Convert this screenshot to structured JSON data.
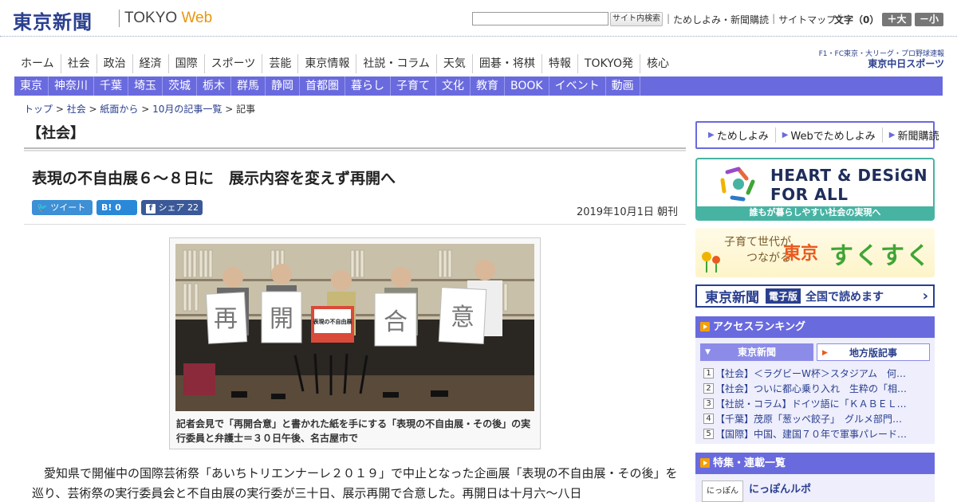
{
  "header": {
    "logo": "東京新聞",
    "logo_tokyo": "TOKYO ",
    "logo_web": "Web",
    "search_placeholder": "",
    "search_button": "サイト内検索",
    "links": [
      "ためしよみ・新聞購読",
      "サイトマップ"
    ],
    "fontsize_label": "文字（0）",
    "font_plus": "＋大",
    "font_minus": "－小"
  },
  "nav_main": [
    "ホーム",
    "社会",
    "政治",
    "経済",
    "国際",
    "スポーツ",
    "芸能",
    "東京情報",
    "社説・コラム",
    "天気",
    "囲碁・将棋",
    "特報",
    "TOKYO発",
    "核心"
  ],
  "chunichi": {
    "line1": "F1・FC東京・大リーグ・プロ野球速報",
    "line2": "東京中日スポーツ"
  },
  "nav_local": [
    "東京",
    "神奈川",
    "千葉",
    "埼玉",
    "茨城",
    "栃木",
    "群馬",
    "静岡",
    "首都圏",
    "暮らし",
    "子育て",
    "文化",
    "教育",
    "BOOK",
    "イベント",
    "動画"
  ],
  "breadcrumb": [
    "トップ",
    "社会",
    "紙面から",
    "10月の記事一覧",
    "記事"
  ],
  "article": {
    "section": "【社会】",
    "headline": "表現の不自由展６～８日に　展示内容を変えず再開へ",
    "share_tweet": "ツイート",
    "share_hatena": "B! 0",
    "share_fb": "シェア 22",
    "date": "2019年10月1日 朝刊",
    "photo_signs": [
      "再",
      "開",
      "合",
      "意"
    ],
    "photo_sign_center": "表現の不自由展",
    "caption": "記者会見で「再開合意」と書かれた紙を手にする「表現の不自由展・その後」の実行委員と弁護士＝３０日午後、名古屋市で",
    "body": "愛知県で開催中の国際芸術祭「あいちトリエンナーレ２０１９」で中止となった企画展「表現の不自由展・その後」を巡り、芸術祭の実行委員会と不自由展の実行委が三十日、展示再開で合意した。再開日は十月六～八日"
  },
  "sidebar": {
    "top_links": [
      "ためしよみ",
      "Webでためしよみ",
      "新聞購読"
    ],
    "heart_line1": "HEART & DESiGN",
    "heart_line2": "FOR ALL",
    "heart_strip": "誰もが暮らしやすい社会の実現へ",
    "suku_small1": "子育て世代が",
    "suku_small2": "つながる",
    "suku_tokyo": "東京",
    "suku_big": "すくすく",
    "denshi_logo": "東京新聞",
    "denshi_badge": "電子版",
    "denshi_read": "全国で読めます",
    "ranking_title": "アクセスランキング",
    "ranking_tabs": [
      "東京新聞",
      "地方版記事"
    ],
    "ranking": [
      {
        "num": "1",
        "text": "【社会】＜ラグビーW杯＞スタジアム　何…"
      },
      {
        "num": "2",
        "text": "【社会】ついに都心乗り入れ　生粋の「相…"
      },
      {
        "num": "3",
        "text": "【社説・コラム】ドイツ語に「ＫＡＢＥＬ…"
      },
      {
        "num": "4",
        "text": "【千葉】茂原「葱ッペ餃子」　グルメ部門…"
      },
      {
        "num": "5",
        "text": "【国際】中国、建国７０年で軍事パレード…"
      }
    ],
    "feature_title": "特集・連載一覧",
    "feature_thumb": "にっぽん",
    "feature_item": "にっぽんルポ"
  },
  "colors": {
    "brand_blue": "#2a3f8f",
    "nav_purple": "#6a6adf",
    "web_orange": "#e8960c",
    "heart_teal": "#47b3a3"
  }
}
